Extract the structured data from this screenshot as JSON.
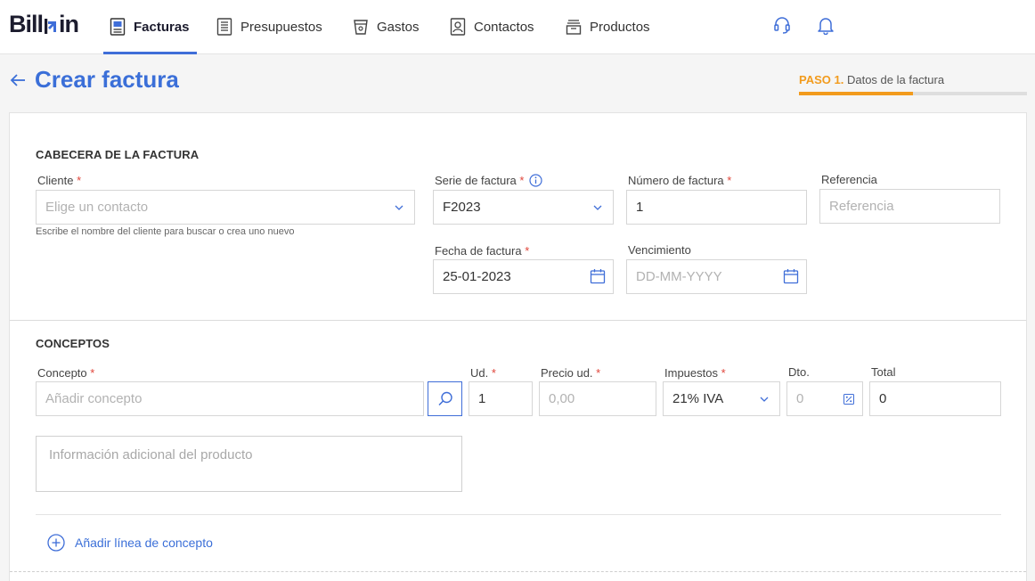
{
  "app": {
    "logo_text_left": "Bill",
    "logo_text_right": "in"
  },
  "nav": {
    "items": [
      {
        "label": "Facturas",
        "icon": "invoice-icon",
        "active": true
      },
      {
        "label": "Presupuestos",
        "icon": "document-list-icon",
        "active": false
      },
      {
        "label": "Gastos",
        "icon": "cup-icon",
        "active": false
      },
      {
        "label": "Contactos",
        "icon": "contact-card-icon",
        "active": false
      },
      {
        "label": "Productos",
        "icon": "box-icon",
        "active": false
      }
    ],
    "right_icons": [
      "headset-icon",
      "bell-icon"
    ]
  },
  "header": {
    "title": "Crear factura",
    "step_prefix": "PASO 1.",
    "step_label": "Datos de la factura",
    "step_progress": 0.5
  },
  "cabecera": {
    "title": "CABECERA DE LA FACTURA",
    "cliente_label": "Cliente",
    "cliente_placeholder": "Elige un contacto",
    "cliente_hint": "Escribe el nombre del cliente para buscar o crea uno nuevo",
    "serie_label": "Serie de factura",
    "serie_value": "F2023",
    "numero_label": "Número de factura",
    "numero_value": "1",
    "referencia_label": "Referencia",
    "referencia_placeholder": "Referencia",
    "fecha_label": "Fecha de factura",
    "fecha_value": "25-01-2023",
    "vencimiento_label": "Vencimiento",
    "vencimiento_placeholder": "DD-MM-YYYY",
    "required_mark": "*"
  },
  "conceptos": {
    "title": "CONCEPTOS",
    "concepto_label": "Concepto",
    "concepto_placeholder": "Añadir concepto",
    "ud_label": "Ud.",
    "ud_value": "1",
    "precio_label": "Precio ud.",
    "precio_placeholder": "0,00",
    "impuestos_label": "Impuestos",
    "impuestos_value": "21% IVA",
    "dto_label": "Dto.",
    "dto_placeholder": "0",
    "total_label": "Total",
    "total_value": "0",
    "info_placeholder": "Información adicional del producto",
    "add_line_label": "Añadir línea de concepto"
  },
  "colors": {
    "accent": "#3f6ed8",
    "step": "#f29b1d",
    "required": "#e0453a"
  }
}
